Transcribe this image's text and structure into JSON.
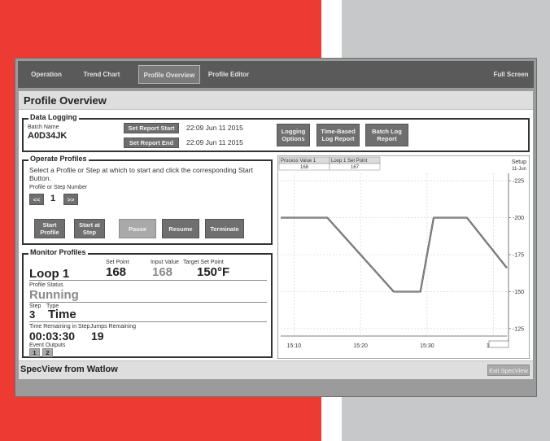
{
  "nav": {
    "tabs": [
      {
        "label": "Operation"
      },
      {
        "label": "Trend Chart"
      },
      {
        "label": "Profile Overview"
      },
      {
        "label": "Profile Editor"
      }
    ],
    "full_screen": "Full Screen"
  },
  "page_title": "Profile Overview",
  "data_logging": {
    "legend": "Data Logging",
    "batch_label": "Batch Name",
    "batch_value": "A0D34JK",
    "set_start": "Set Report Start",
    "start_time": "22:09 Jun 11 2015",
    "set_end": "Set Report End",
    "end_time": "22:09 Jun 11 2015",
    "logging_options": "Logging Options",
    "time_based": "Time-Based Log Report",
    "batch_report": "Batch Log Report"
  },
  "operate": {
    "legend": "Operate Profiles",
    "instruction": "Select a Profile or Step at which to start and click the corresponding Start Button.",
    "number_label": "Profile or Step Number",
    "prev": "<<",
    "value": "1",
    "next": ">>",
    "start_profile": "Start Profile",
    "start_step": "Start at Step",
    "pause": "Pause",
    "resume": "Resume",
    "terminate": "Terminate"
  },
  "monitor": {
    "legend": "Monitor Profiles",
    "loop": "Loop 1",
    "set_point_label": "Set Point",
    "set_point": "168",
    "input_label": "Input Value",
    "input_value": "168",
    "target_label": "Target Set Point",
    "target_value": "150°F",
    "status_label": "Profile Status",
    "status": "Running",
    "step_label": "Step",
    "step": "3",
    "type_label": "Type",
    "type": "Time",
    "time_rem_label": "Time Remaining in Step",
    "time_rem": "00:03:30",
    "jumps_label": "Jumps Remaining",
    "jumps": "19",
    "event_label": "Event Outputs",
    "events": [
      "1",
      "2"
    ]
  },
  "chart_header": {
    "col1_label": "Process Value 1",
    "col1_value": "168",
    "col2_label": "Loop 1 Set Point",
    "col2_value": "167",
    "setup": "Setup",
    "date": "11-Jun"
  },
  "footer": {
    "title": "SpecView from Watlow",
    "exit": "Exit SpecView"
  },
  "chart_data": {
    "type": "line",
    "x_ticks": [
      "15:10",
      "15:20",
      "15:30",
      "15:40"
    ],
    "y_ticks": [
      "225",
      "200",
      "175",
      "150",
      "125"
    ],
    "ylim": [
      120,
      230
    ],
    "xlim": [
      0,
      34
    ],
    "series": [
      {
        "name": "Process Value 1",
        "x": [
          0,
          3,
          7,
          17,
          21,
          23,
          25,
          28,
          34
        ],
        "y": [
          200,
          200,
          200,
          150,
          150,
          200,
          200,
          200,
          166
        ]
      },
      {
        "name": "Loop 1 Set Point",
        "x": [
          0,
          3,
          7,
          17,
          21,
          23,
          25,
          28,
          34
        ],
        "y": [
          200,
          200,
          200,
          150,
          150,
          200,
          200,
          200,
          166
        ]
      }
    ],
    "colors": {
      "process": "#555555",
      "setpoint": "#8a8a8a"
    }
  }
}
